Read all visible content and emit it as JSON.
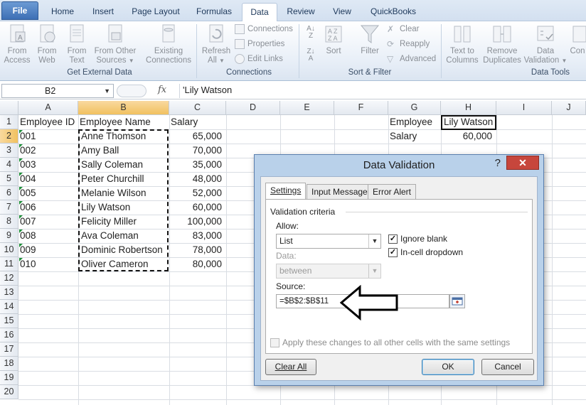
{
  "ribbon_tabs": [
    "File",
    "Home",
    "Insert",
    "Page Layout",
    "Formulas",
    "Data",
    "Review",
    "View",
    "QuickBooks"
  ],
  "ribbon": {
    "get_external_data": {
      "label": "Get External Data",
      "buttons": [
        {
          "l1": "From",
          "l2": "Access",
          "icon": "access-db-icon"
        },
        {
          "l1": "From",
          "l2": "Web",
          "icon": "web-icon"
        },
        {
          "l1": "From",
          "l2": "Text",
          "icon": "text-file-icon"
        },
        {
          "l1": "From Other",
          "l2": "Sources",
          "icon": "other-sources-icon"
        },
        {
          "l1": "Existing",
          "l2": "Connections",
          "icon": "existing-connections-icon"
        }
      ]
    },
    "connections": {
      "label": "Connections",
      "refresh": {
        "l1": "Refresh",
        "l2": "All"
      },
      "small": [
        "Connections",
        "Properties",
        "Edit Links"
      ]
    },
    "sort_filter": {
      "label": "Sort & Filter",
      "sort": "Sort",
      "filter": "Filter",
      "small": [
        "Clear",
        "Reapply",
        "Advanced"
      ]
    },
    "data_tools": {
      "label": "Data Tools",
      "buttons": [
        {
          "l1": "Text to",
          "l2": "Columns"
        },
        {
          "l1": "Remove",
          "l2": "Duplicates"
        },
        {
          "l1": "Data",
          "l2": "Validation"
        },
        {
          "l1": "Con",
          "l2": ""
        }
      ]
    }
  },
  "formula_bar": {
    "name_box": "B2",
    "fx": "fx",
    "content": "'Lily Watson"
  },
  "columns": [
    "A",
    "B",
    "C",
    "D",
    "E",
    "F",
    "G",
    "H",
    "I",
    "J"
  ],
  "rows": [
    "1",
    "2",
    "3",
    "4",
    "5",
    "6",
    "7",
    "8",
    "9",
    "10",
    "11",
    "12",
    "13",
    "14",
    "15",
    "16",
    "17",
    "18",
    "19",
    "20"
  ],
  "sheet": {
    "headers": [
      "Employee ID",
      "Employee Name",
      "Salary"
    ],
    "records": [
      {
        "id": "001",
        "name": "Anne Thomson",
        "salary": "65,000"
      },
      {
        "id": "002",
        "name": "Amy Ball",
        "salary": "70,000"
      },
      {
        "id": "003",
        "name": "Sally Coleman",
        "salary": "35,000"
      },
      {
        "id": "004",
        "name": "Peter Churchill",
        "salary": "48,000"
      },
      {
        "id": "005",
        "name": "Melanie Wilson",
        "salary": "52,000"
      },
      {
        "id": "006",
        "name": "Lily Watson",
        "salary": "60,000"
      },
      {
        "id": "007",
        "name": "Felicity Miller",
        "salary": "100,000"
      },
      {
        "id": "008",
        "name": "Ava Coleman",
        "salary": "83,000"
      },
      {
        "id": "009",
        "name": "Dominic Robertson",
        "salary": "78,000"
      },
      {
        "id": "010",
        "name": "Oliver Cameron",
        "salary": "80,000"
      }
    ],
    "lookup": {
      "employee_label": "Employee",
      "employee_value": "Lily Watson",
      "salary_label": "Salary",
      "salary_value": "60,000"
    }
  },
  "dialog": {
    "title": "Data Validation",
    "help": "?",
    "close": "✕",
    "tabs": [
      "Settings",
      "Input Message",
      "Error Alert"
    ],
    "criteria_label": "Validation criteria",
    "allow_label": "Allow:",
    "allow_value": "List",
    "ignore_blank": "Ignore blank",
    "in_cell_dropdown": "In-cell dropdown",
    "data_label": "Data:",
    "data_value": "between",
    "source_label": "Source:",
    "source_value": "=$B$2:$B$11",
    "apply_all": "Apply these changes to all other cells with the same settings",
    "clear_all": "Clear All",
    "ok": "OK",
    "cancel": "Cancel"
  }
}
